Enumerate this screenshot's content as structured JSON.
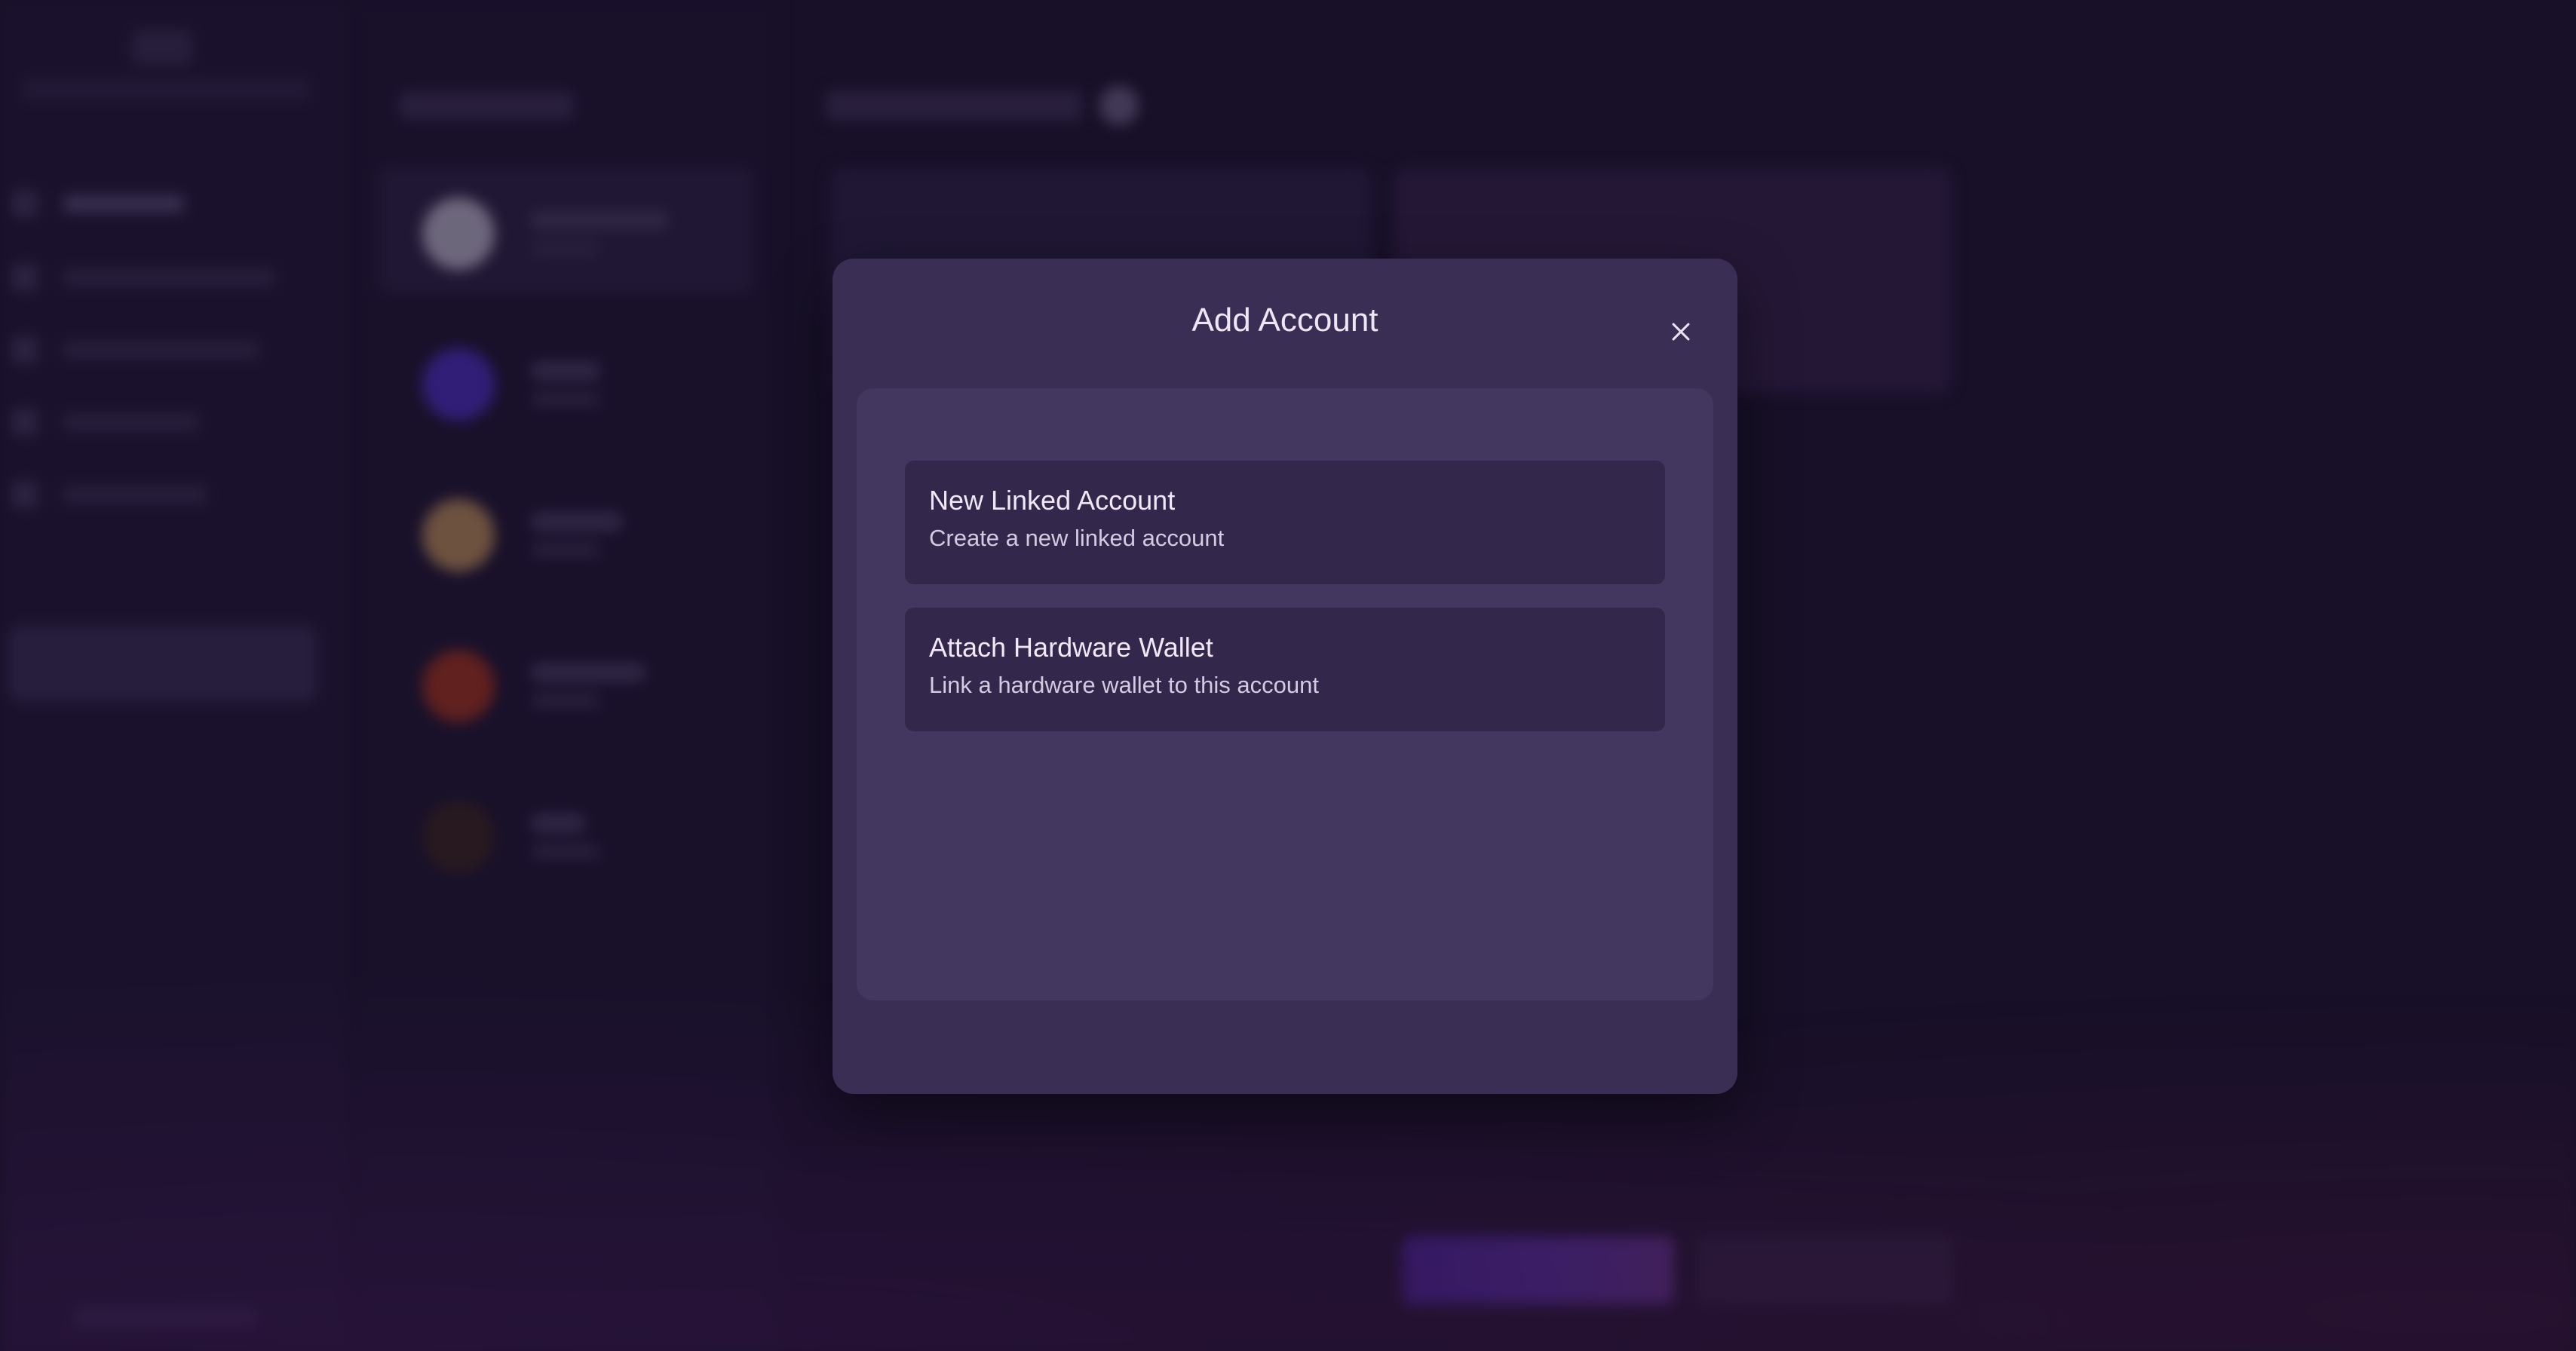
{
  "modal": {
    "title": "Add Account",
    "close_icon": "close-icon",
    "options": [
      {
        "title": "New Linked Account",
        "subtitle": "Create a new linked account"
      },
      {
        "title": "Attach Hardware Wallet",
        "subtitle": "Link a hardware wallet to this account"
      }
    ]
  },
  "colors": {
    "page_background": "#1d1430",
    "modal_background": "#3a2e55",
    "modal_body": "#43375f",
    "option_background": "#33284c",
    "text_primary": "#efe9f7",
    "text_secondary": "#d3cbe2"
  }
}
